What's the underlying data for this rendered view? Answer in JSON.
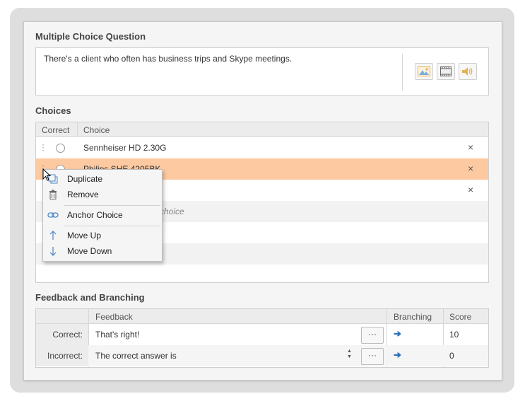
{
  "question": {
    "title": "Multiple Choice Question",
    "text": "There's a client who often has business trips and Skype meetings.",
    "media_buttons": [
      {
        "name": "image-icon",
        "color": "#e8b04a"
      },
      {
        "name": "video-icon",
        "color": "#666666"
      },
      {
        "name": "audio-icon",
        "color": "#e8b04a"
      }
    ]
  },
  "choices": {
    "title": "Choices",
    "columns": {
      "correct": "Correct",
      "choice": "Choice"
    },
    "rows": [
      {
        "label": "Sennheiser HD 2.30G",
        "highlighted": false
      },
      {
        "label": "Philips SHE 4205BK",
        "highlighted": true
      },
      {
        "label": "",
        "highlighted": false
      }
    ],
    "add_placeholder": "choice",
    "remove_glyph": "×"
  },
  "context_menu": {
    "items": [
      {
        "label": "Duplicate",
        "icon": "duplicate-icon"
      },
      {
        "label": "Remove",
        "icon": "trash-icon"
      },
      {
        "label": "Anchor Choice",
        "icon": "link-icon"
      },
      {
        "label": "Move Up",
        "icon": "arrow-up-icon"
      },
      {
        "label": "Move Down",
        "icon": "arrow-down-icon"
      }
    ]
  },
  "feedback": {
    "title": "Feedback and Branching",
    "columns": {
      "feedback": "Feedback",
      "branching": "Branching",
      "score": "Score"
    },
    "rows": [
      {
        "label": "Correct:",
        "text": "That's right!",
        "more": "···",
        "branch": "➔",
        "score": "10"
      },
      {
        "label": "Incorrect:",
        "text": "The correct answer is",
        "more": "···",
        "branch": "➔",
        "score": "0"
      }
    ]
  },
  "colors": {
    "highlight_row": "#fdc9a0",
    "arrow": "#2a6fb6"
  }
}
